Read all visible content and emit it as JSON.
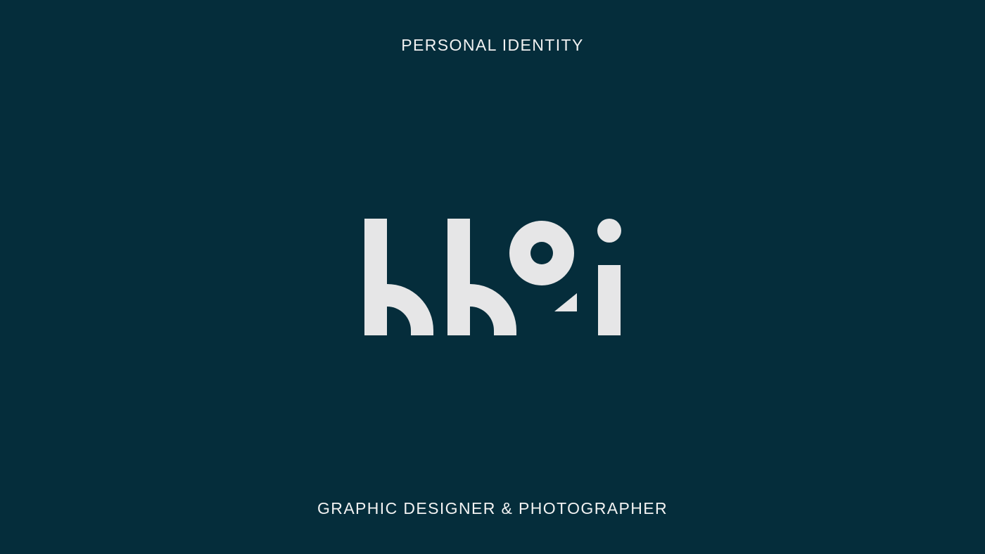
{
  "header": {
    "label": "PERSONAL IDENTITY"
  },
  "logo": {
    "wordmark": "khoi",
    "mark_color": "#e6e6e7"
  },
  "footer": {
    "tagline": "GRAPHIC DESIGNER & PHOTOGRAPHER"
  },
  "colors": {
    "background": "#052d3b",
    "text": "#f2f2f2"
  }
}
